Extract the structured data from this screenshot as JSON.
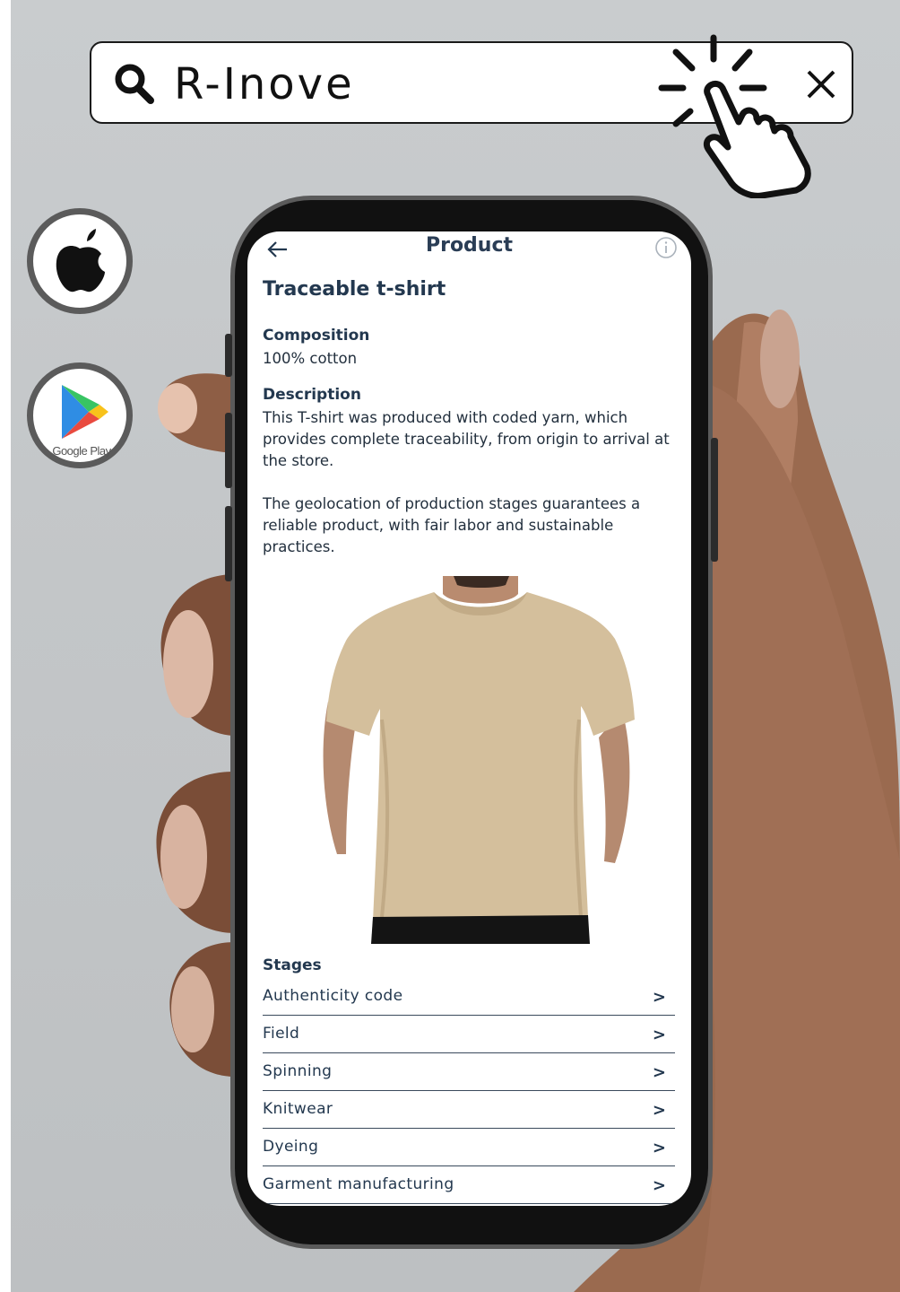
{
  "search": {
    "query": "R-Inove"
  },
  "store_badges": [
    {
      "name": "apple-app-store-badge",
      "icon": "apple-icon"
    },
    {
      "name": "google-play-badge",
      "icon": "google-play-icon",
      "label": "Google Play"
    }
  ],
  "app": {
    "header_title": "Product",
    "product_title": "Traceable t-shirt",
    "composition_label": "Composition",
    "composition_value": "100% cotton",
    "description_label": "Description",
    "description_p1": "This T-shirt was produced with coded yarn, which provides complete traceability, from origin to arrival at the store.",
    "description_p2": "The geolocation of production stages guarantees a reliable product, with fair labor and sustainable practices.",
    "stages_label": "Stages",
    "stages": [
      {
        "label": "Authenticity code"
      },
      {
        "label": "Field"
      },
      {
        "label": "Spinning"
      },
      {
        "label": "Knitwear"
      },
      {
        "label": "Dyeing"
      },
      {
        "label": "Garment manufacturing"
      }
    ]
  },
  "colors": {
    "heading": "#23384f",
    "shirt": "#d4bf9c",
    "background": "#c6c9cb"
  }
}
